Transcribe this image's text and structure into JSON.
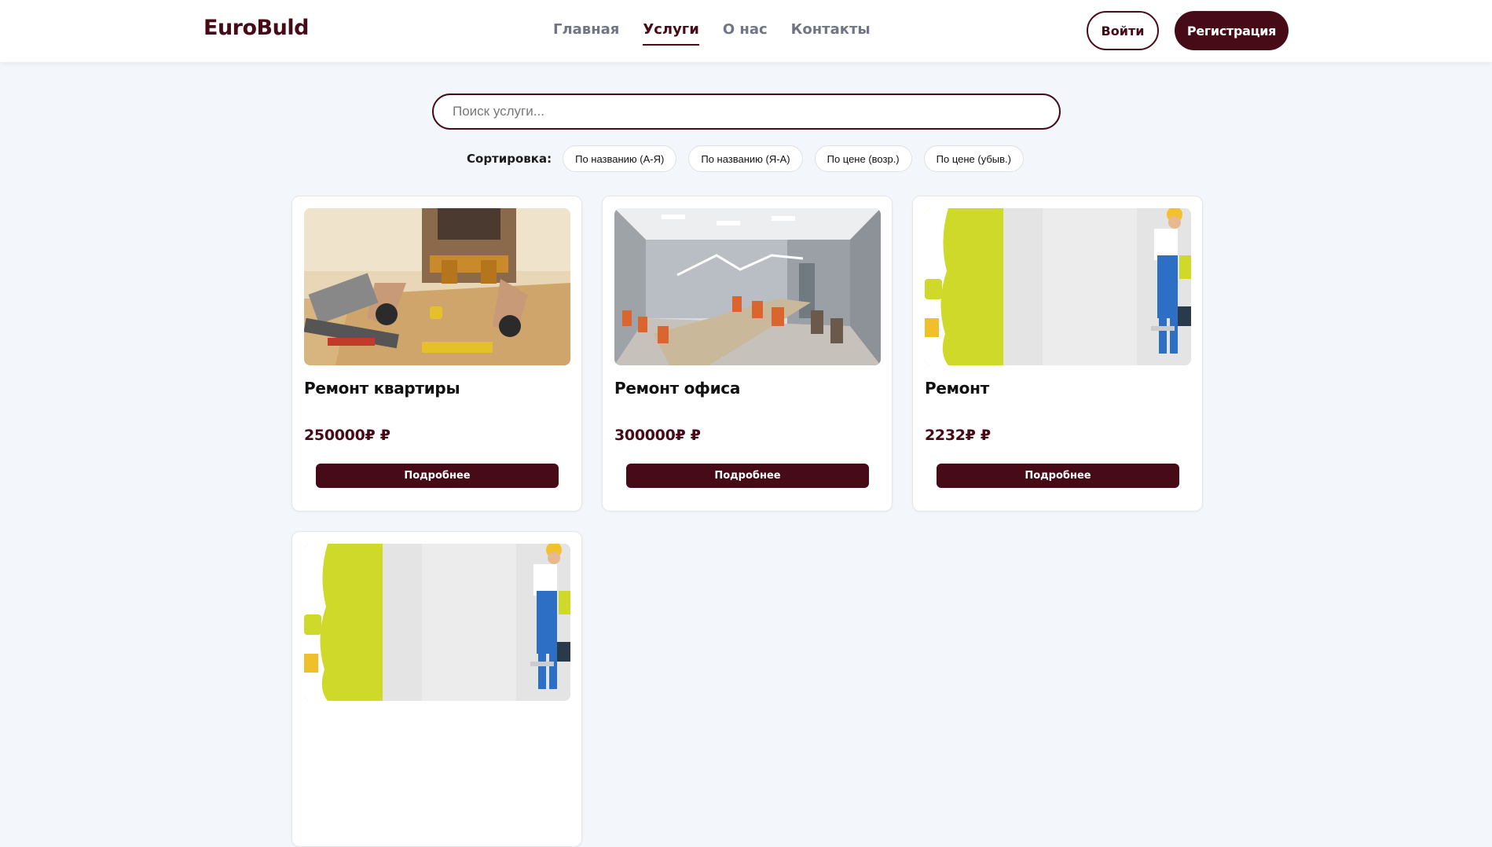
{
  "header": {
    "logo": "EuroBuld",
    "nav": [
      {
        "label": "Главная",
        "active": false
      },
      {
        "label": "Услуги",
        "active": true
      },
      {
        "label": "О нас",
        "active": false
      },
      {
        "label": "Контакты",
        "active": false
      }
    ],
    "login_label": "Войти",
    "register_label": "Регистрация"
  },
  "search": {
    "placeholder": "Поиск услуги...",
    "value": ""
  },
  "sort": {
    "label": "Сортировка:",
    "options": [
      "По названию (А-Я)",
      "По названию (Я-А)",
      "По цене (возр.)",
      "По цене (убыв.)"
    ]
  },
  "services": [
    {
      "title": "Ремонт квартиры",
      "price": "250000₽ ₽",
      "button": "Подробнее",
      "image": "carpenter-workbench-photo"
    },
    {
      "title": "Ремонт офиса",
      "price": "300000₽ ₽",
      "button": "Подробнее",
      "image": "office-conference-room-photo"
    },
    {
      "title": "Ремонт",
      "price": "2232₽ ₽",
      "button": "Подробнее",
      "image": "wall-painter-photo"
    },
    {
      "title": "",
      "price": "",
      "button": "",
      "image": "wall-painter-photo"
    }
  ],
  "colors": {
    "brand": "#470a17",
    "background": "#f3f6fa",
    "nav_inactive": "#6f7585"
  }
}
